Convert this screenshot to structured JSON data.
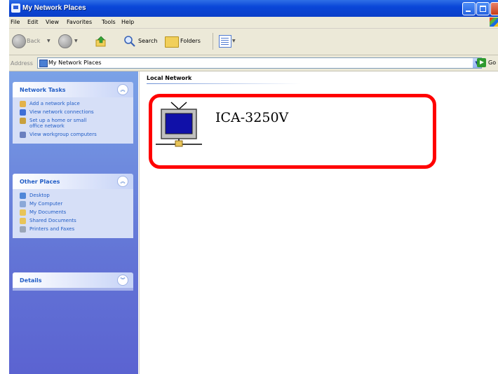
{
  "window": {
    "title": "My Network Places"
  },
  "menu": [
    "File",
    "Edit",
    "View",
    "Favorites",
    "Tools",
    "Help"
  ],
  "toolbar": {
    "back": "Back",
    "search": "Search",
    "folders": "Folders"
  },
  "address": {
    "label": "Address",
    "value": "My Network Places",
    "go": "Go"
  },
  "taskpane": {
    "network_tasks": {
      "title": "Network Tasks",
      "items": [
        "Add a network place",
        "View network connections",
        "Set up a home or small",
        "office network",
        "View workgroup computers"
      ]
    },
    "other_places": {
      "title": "Other Places",
      "items": [
        "Desktop",
        "My Computer",
        "My Documents",
        "Shared Documents",
        "Printers and Faxes"
      ]
    },
    "details": {
      "title": "Details"
    }
  },
  "content": {
    "group_title": "Local Network",
    "device": {
      "name": "ICA-3250V",
      "icon": "network-camera-device-icon"
    }
  },
  "colors": {
    "highlight": "#ff0000",
    "titlebar": "#0a46d8",
    "link": "#215dc6"
  }
}
